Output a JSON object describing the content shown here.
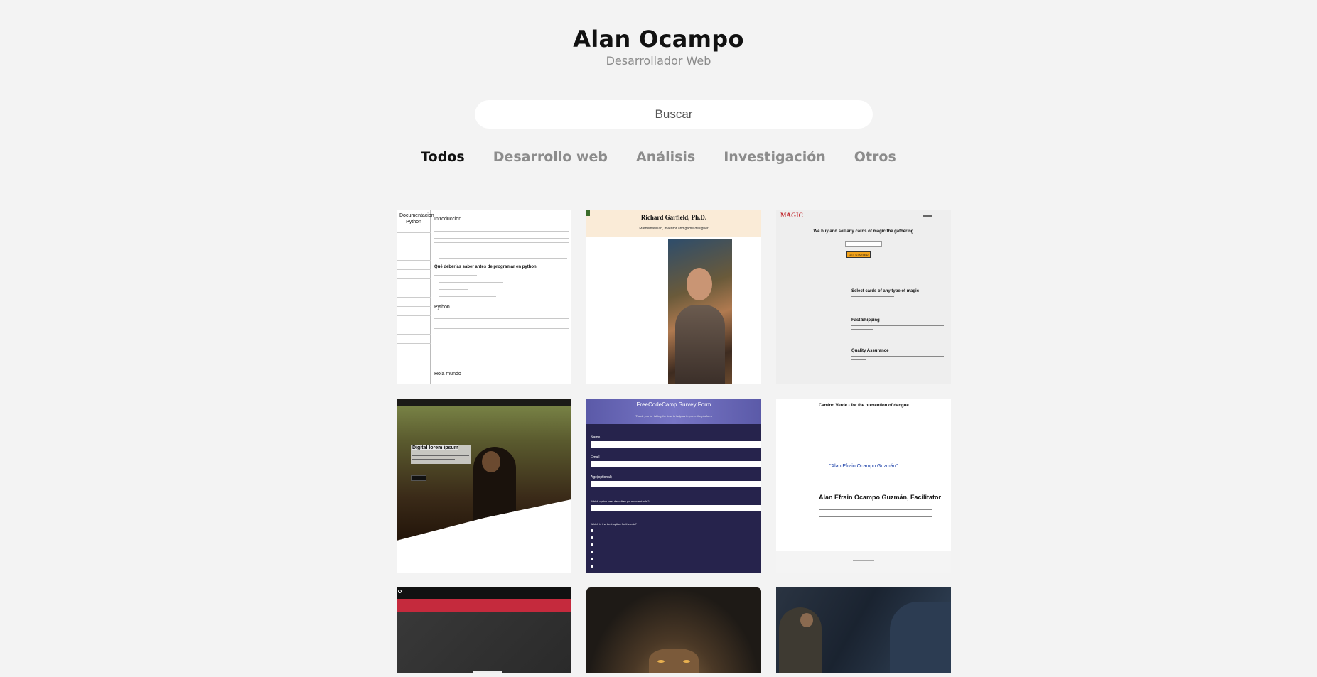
{
  "header": {
    "title": "Alan Ocampo",
    "subtitle": "Desarrollador Web"
  },
  "search": {
    "placeholder": "Buscar",
    "value": ""
  },
  "tabs": [
    {
      "label": "Todos",
      "active": true
    },
    {
      "label": "Desarrollo web",
      "active": false
    },
    {
      "label": "Análisis",
      "active": false
    },
    {
      "label": "Investigación",
      "active": false
    },
    {
      "label": "Otros",
      "active": false
    }
  ],
  "projects": {
    "doc": {
      "sidebar_title": "Documentacion Python",
      "h1": "Introduccion",
      "h2": "Qué deberías saber antes de programar en python",
      "h3": "Python",
      "h4": "Hola mundo"
    },
    "tribute": {
      "name": "Richard Garfield, Ph.D.",
      "caption": "Mathematician, inventor and game designer"
    },
    "magic": {
      "logo": "MAGIC",
      "headline": "We buy and sell any cards of magic the gathering",
      "cta": "GET STARTED",
      "f1": "Select cards of any type of magic",
      "f2": "Fast Shipping",
      "f3": "Quality Assurance"
    },
    "landing": {
      "heading": "Digital lorem ipsum"
    },
    "survey": {
      "title": "FreeCodeCamp Survey Form",
      "subtitle": "Thank you for taking the time to help us improve the platform",
      "name_label": "Name",
      "email_label": "Email",
      "age_label": "Age(optional)",
      "q1": "Which option best describes your current role?",
      "q2": "Which is the best option for the role?"
    },
    "camino": {
      "brand": "Camino Verde - for the prevention of dengue",
      "quote": "\"Alan Efrain Ocampo Guzmán\"",
      "name": "Alan Efrain Ocampo Guzmán, Facilitator"
    }
  },
  "colors": {
    "background": "#f3f3f3",
    "survey_purple": "#26234c",
    "magic_orange": "#f2a21a",
    "banner_red": "#c52a3d"
  }
}
